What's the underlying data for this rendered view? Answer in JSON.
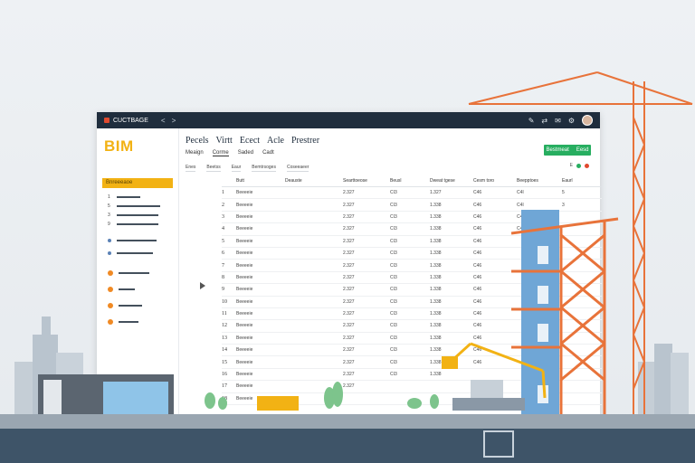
{
  "titlebar": {
    "brand": "CUCTBAGE",
    "nav": [
      "<",
      ">"
    ],
    "icons": [
      "wrench-icon",
      "share-icon",
      "mail-icon",
      "settings-icon"
    ]
  },
  "app": {
    "title": "BIM"
  },
  "sidebar": {
    "active_label": "Bnreeeaoe",
    "items": [
      {
        "num": "1",
        "icon": "none"
      },
      {
        "num": "5",
        "icon": "none"
      },
      {
        "num": "3",
        "icon": "none"
      },
      {
        "num": "9",
        "icon": "none"
      },
      {
        "num": "",
        "icon": "blue"
      },
      {
        "num": "",
        "icon": "blue"
      },
      {
        "num": "",
        "icon": "orange"
      },
      {
        "num": "",
        "icon": "orange"
      },
      {
        "num": "",
        "icon": "orange"
      },
      {
        "num": "",
        "icon": "orange"
      }
    ]
  },
  "menu": [
    "Pecels",
    "Virtt",
    "Ecect",
    "Acle",
    "Prestrer"
  ],
  "subtabs": [
    "Meaign",
    "Corme",
    "Saded",
    "Cadt"
  ],
  "actions": {
    "primary_left": "Bestmeat",
    "primary_right": "Eesd",
    "status": "E"
  },
  "filters": [
    "Enes",
    "Beetss",
    "Eaur",
    "Bemtrsoges",
    "Coseeaeer"
  ],
  "table": {
    "headers": [
      "",
      "Butt",
      "Deauste",
      "Searttoeose",
      "Beusl",
      "Dweat tgese",
      "Cesm toro",
      "Beepptoes",
      "Eaurl"
    ],
    "rows": [
      [
        "1",
        "Beeeeie",
        "",
        "2.327",
        "CI3",
        "1.327",
        "C46",
        "C4I",
        "5"
      ],
      [
        "2",
        "Beeeeie",
        "",
        "2.327",
        "CI3",
        "1.338",
        "C46",
        "C4I",
        "3"
      ],
      [
        "3",
        "Beeeeie",
        "",
        "2.327",
        "CI3",
        "1.338",
        "C46",
        "C4I",
        ""
      ],
      [
        "4",
        "Beeeeie",
        "",
        "2.327",
        "CI3",
        "1.338",
        "C46",
        "C4I",
        ""
      ],
      [
        "5",
        "Beeeeie",
        "",
        "2.327",
        "CI3",
        "1.338",
        "C46",
        "",
        ""
      ],
      [
        "6",
        "Beeeeie",
        "",
        "2.327",
        "CI3",
        "1.338",
        "C46",
        "",
        ""
      ],
      [
        "7",
        "Beeeeie",
        "",
        "2.327",
        "CI3",
        "1.338",
        "C46",
        "",
        ""
      ],
      [
        "8",
        "Beeeeie",
        "",
        "2.327",
        "CI3",
        "1.338",
        "C46",
        "",
        ""
      ],
      [
        "9",
        "Beeeeie",
        "",
        "2.327",
        "CI3",
        "1.338",
        "C46",
        "",
        ""
      ],
      [
        "10",
        "Beeeeie",
        "",
        "2.327",
        "CI3",
        "1.338",
        "C46",
        "",
        ""
      ],
      [
        "11",
        "Beeeeie",
        "",
        "2.327",
        "CI3",
        "1.338",
        "C46",
        "",
        ""
      ],
      [
        "12",
        "Beeeeie",
        "",
        "2.327",
        "CI3",
        "1.338",
        "C46",
        "",
        ""
      ],
      [
        "13",
        "Beeeeie",
        "",
        "2.327",
        "CI3",
        "1.338",
        "C46",
        "",
        ""
      ],
      [
        "14",
        "Beeeeie",
        "",
        "2.327",
        "CI3",
        "1.338",
        "C46",
        "",
        ""
      ],
      [
        "15",
        "Beeeeie",
        "",
        "2.327",
        "CI3",
        "1.338",
        "C46",
        "",
        ""
      ],
      [
        "16",
        "Beeeeie",
        "",
        "2.327",
        "CI3",
        "1.338",
        "",
        "",
        ""
      ],
      [
        "17",
        "Beeeeie",
        "",
        "2.327",
        "",
        "",
        "",
        "",
        ""
      ],
      [
        "18",
        "Beeeeie",
        "",
        "",
        "",
        "",
        "",
        "",
        ""
      ]
    ]
  },
  "colors": {
    "accent": "#f2b214",
    "titlebar": "#1f2d3d",
    "primary": "#27ae60",
    "crane": "#e8733a"
  }
}
